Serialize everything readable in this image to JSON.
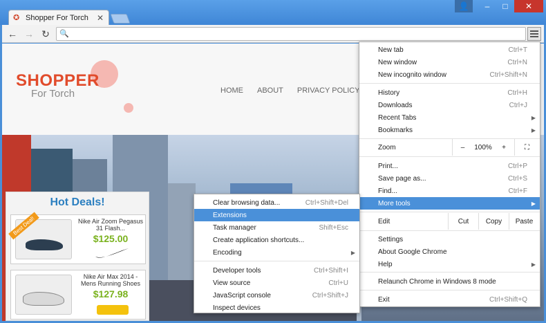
{
  "window": {
    "tab_title": "Shopper For Torch",
    "tab_close": "✕",
    "user_icon": "👤",
    "minimize": "–",
    "maximize": "□",
    "close": "✕"
  },
  "toolbar": {
    "back": "←",
    "forward": "→",
    "reload": "↻",
    "search_glyph": "🔍"
  },
  "site": {
    "logo_main": "SHOPPER",
    "logo_sub": "For Torch",
    "nav": [
      "HOME",
      "ABOUT",
      "PRIVACY POLICY"
    ],
    "deals_title": "Hot Deals!",
    "deals": [
      {
        "name": "Nike Air Zoom Pegasus 31 Flash...",
        "price": "$125.00",
        "badge": "Best Deal!"
      },
      {
        "name": "Nike Air Max 2014 - Mens Running Shoes",
        "price": "$127.98",
        "badge": ""
      }
    ]
  },
  "menu": {
    "items": [
      {
        "label": "New tab",
        "shortcut": "Ctrl+T"
      },
      {
        "label": "New window",
        "shortcut": "Ctrl+N"
      },
      {
        "label": "New incognito window",
        "shortcut": "Ctrl+Shift+N"
      },
      {
        "label": "History",
        "shortcut": "Ctrl+H"
      },
      {
        "label": "Downloads",
        "shortcut": "Ctrl+J"
      },
      {
        "label": "Recent Tabs",
        "shortcut": ""
      },
      {
        "label": "Bookmarks",
        "shortcut": ""
      },
      {
        "label": "Zoom",
        "shortcut": ""
      },
      {
        "label": "Print...",
        "shortcut": "Ctrl+P"
      },
      {
        "label": "Save page as...",
        "shortcut": "Ctrl+S"
      },
      {
        "label": "Find...",
        "shortcut": "Ctrl+F"
      },
      {
        "label": "More tools",
        "shortcut": ""
      },
      {
        "label": "Edit",
        "shortcut": ""
      },
      {
        "label": "Settings",
        "shortcut": ""
      },
      {
        "label": "About Google Chrome",
        "shortcut": ""
      },
      {
        "label": "Help",
        "shortcut": ""
      },
      {
        "label": "Relaunch Chrome in Windows 8 mode",
        "shortcut": ""
      },
      {
        "label": "Exit",
        "shortcut": "Ctrl+Shift+Q"
      }
    ],
    "zoom": {
      "minus": "–",
      "value": "100%",
      "plus": "+",
      "fullscreen": "⛶"
    },
    "edit": {
      "cut": "Cut",
      "copy": "Copy",
      "paste": "Paste"
    }
  },
  "submenu": {
    "items": [
      {
        "label": "Clear browsing data...",
        "shortcut": "Ctrl+Shift+Del"
      },
      {
        "label": "Extensions",
        "shortcut": ""
      },
      {
        "label": "Task manager",
        "shortcut": "Shift+Esc"
      },
      {
        "label": "Create application shortcuts...",
        "shortcut": ""
      },
      {
        "label": "Encoding",
        "shortcut": ""
      },
      {
        "label": "Developer tools",
        "shortcut": "Ctrl+Shift+I"
      },
      {
        "label": "View source",
        "shortcut": "Ctrl+U"
      },
      {
        "label": "JavaScript console",
        "shortcut": "Ctrl+Shift+J"
      },
      {
        "label": "Inspect devices",
        "shortcut": ""
      }
    ]
  },
  "colors": {
    "highlight": "#4a90d9",
    "title_bar": "#3f86d6",
    "logo_red": "#e14c2c",
    "deal_price": "#7ab21e",
    "deals_title": "#2b7fc0"
  }
}
